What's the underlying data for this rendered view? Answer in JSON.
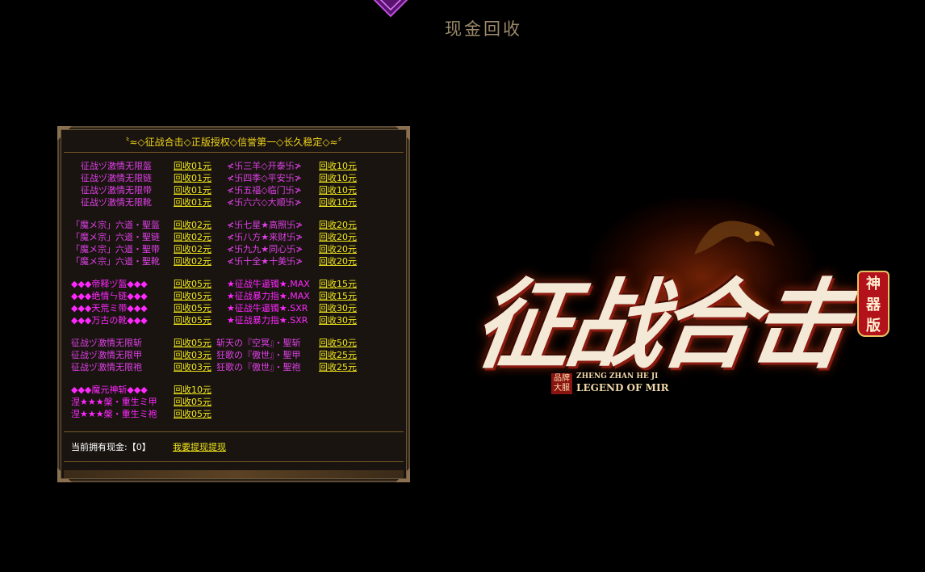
{
  "page": {
    "title": "现金回收"
  },
  "panel": {
    "header": "〝≈◇征战合击◇正版授权◇信誉第一◇长久稳定◇≈〞",
    "groups": [
      {
        "rows": [
          {
            "item1": "征战ヅ激情无限盔",
            "link1": "回收01元",
            "item2": "≮卐三羊◇开泰卐≯",
            "link2": "回收10元"
          },
          {
            "item1": "征战ヅ激情无限链",
            "link1": "回收01元",
            "item2": "≮卐四季◇平安卐≯",
            "link2": "回收10元"
          },
          {
            "item1": "征战ヅ激情无限带",
            "link1": "回收01元",
            "item2": "≮卐五福◇临门卐≯",
            "link2": "回收10元"
          },
          {
            "item1": "征战ヅ激情无限靴",
            "link1": "回收01元",
            "item2": "≮卐六六◇大顺卐≯",
            "link2": "回收10元"
          }
        ]
      },
      {
        "rows": [
          {
            "item1": "「魔メ宗」六道・聖盔",
            "link1": "回收02元",
            "item2": "≮卐七星★高照卐≯",
            "link2": "回收20元"
          },
          {
            "item1": "「魔メ宗」六道・聖链",
            "link1": "回收02元",
            "item2": "≮卐八方★来财卐≯",
            "link2": "回收20元"
          },
          {
            "item1": "「魔メ宗」六道・聖带",
            "link1": "回收02元",
            "item2": "≮卐九九★同心卐≯",
            "link2": "回收20元"
          },
          {
            "item1": "「魔メ宗」六道・聖靴",
            "link1": "回收02元",
            "item2": "≮卐十全★十美卐≯",
            "link2": "回收20元"
          }
        ]
      },
      {
        "rows": [
          {
            "item1": "◆◆◆帝释ヅ盔◆◆◆",
            "link1": "回收05元",
            "item2": "★征战牛逼镯★.MAX",
            "link2": "回收15元"
          },
          {
            "item1": "◆◆◆绝情ㄣ链◆◆◆",
            "link1": "回收05元",
            "item2": "★征战暴力指★.MAX",
            "link2": "回收15元"
          },
          {
            "item1": "◆◆◆天荒ミ带◆◆◆",
            "link1": "回收05元",
            "item2": "★征战牛逼镯★.SXR",
            "link2": "回收30元"
          },
          {
            "item1": "◆◆◆万古の靴◆◆◆",
            "link1": "回收05元",
            "item2": "★征战暴力指★.SXR",
            "link2": "回收30元"
          }
        ]
      },
      {
        "rows": [
          {
            "item1": "征战ヅ激情无限斩",
            "link1": "回收05元",
            "item2": "斩天の『空冥』・聖斩",
            "link2": "回收50元"
          },
          {
            "item1": "征战ヅ激情无限甲",
            "link1": "回收03元",
            "item2": "狂歌の『傲世』・聖甲",
            "link2": "回收25元"
          },
          {
            "item1": "征战ヅ激情无限袍",
            "link1": "回收03元",
            "item2": "狂歌の『傲世』・聖袍",
            "link2": "回收25元"
          }
        ]
      },
      {
        "rows": [
          {
            "item1": "◆◆◆魔元神斩◆◆◆",
            "link1": "回收10元",
            "item2": "",
            "link2": ""
          },
          {
            "item1": "涅★★★槃・重生ミ甲",
            "link1": "回收05元",
            "item2": "",
            "link2": ""
          },
          {
            "item1": "涅★★★槃・重生ミ袍",
            "link1": "回收05元",
            "item2": "",
            "link2": ""
          }
        ]
      }
    ],
    "cash_label": "当前拥有现金:【0】",
    "withdraw_label": "我要提现提现"
  },
  "logo": {
    "title": "征战合击",
    "badge": [
      "神",
      "器",
      "版"
    ],
    "brand": "品牌大服",
    "pinyin": "ZHENG ZHAN HE JI",
    "english": "LEGEND OF MIR"
  },
  "colors": {
    "item_text": "#e040e8",
    "link_text": "#f2e71b",
    "header_text": "#f2d51b",
    "title_text": "#9b8a6a"
  }
}
